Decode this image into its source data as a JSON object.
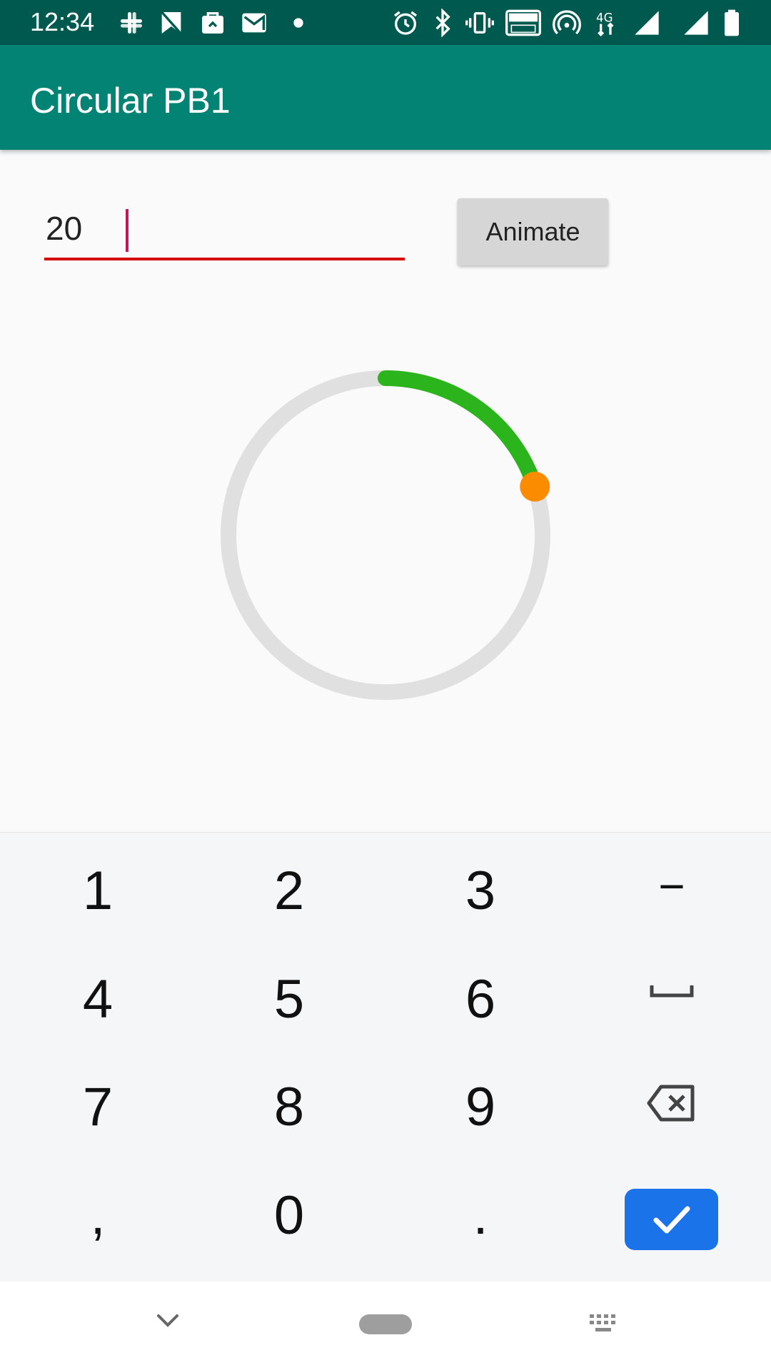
{
  "status_bar": {
    "time": "12:34",
    "icons": [
      "slack-icon",
      "bookmark-icon",
      "bag-icon",
      "gmail-icon",
      "dot-icon",
      "alarm-icon",
      "bluetooth-icon",
      "vibrate-icon",
      "volte-icon",
      "hotspot-icon",
      "network-4g-icon",
      "signal-icon",
      "signal-icon",
      "battery-icon"
    ]
  },
  "app_bar": {
    "title": "Circular PB1"
  },
  "input": {
    "value": "20"
  },
  "animate_button": {
    "label": "Animate"
  },
  "progress": {
    "value_percent": 20,
    "track_color": "#e0e0e0",
    "progress_color": "#2bb41b",
    "thumb_color": "#fb8c00"
  },
  "keyboard": {
    "rows": [
      [
        "1",
        "2",
        "3",
        "−"
      ],
      [
        "4",
        "5",
        "6",
        "space-icon"
      ],
      [
        "7",
        "8",
        "9",
        "backspace-icon"
      ],
      [
        ",",
        "0",
        ".",
        "check-icon"
      ]
    ],
    "enter_color": "#1a73e8"
  },
  "nav_bar": {
    "icons": [
      "chevron-down-icon",
      "home-pill-icon",
      "keyboard-icon"
    ]
  }
}
